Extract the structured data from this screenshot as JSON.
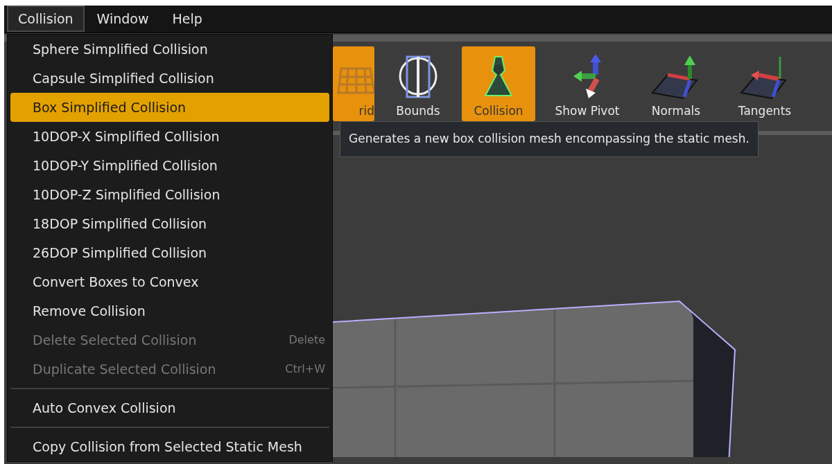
{
  "menubar": [
    {
      "label": "Collision",
      "selected": true
    },
    {
      "label": "Window",
      "selected": false
    },
    {
      "label": "Help",
      "selected": false
    }
  ],
  "menu": [
    {
      "kind": "item",
      "label": "Sphere Simplified Collision",
      "selected": false,
      "disabled": false
    },
    {
      "kind": "item",
      "label": "Capsule Simplified Collision",
      "selected": false,
      "disabled": false
    },
    {
      "kind": "item",
      "label": "Box Simplified Collision",
      "selected": true,
      "disabled": false
    },
    {
      "kind": "item",
      "label": "10DOP-X Simplified Collision",
      "selected": false,
      "disabled": false
    },
    {
      "kind": "item",
      "label": "10DOP-Y Simplified Collision",
      "selected": false,
      "disabled": false
    },
    {
      "kind": "item",
      "label": "10DOP-Z Simplified Collision",
      "selected": false,
      "disabled": false
    },
    {
      "kind": "item",
      "label": "18DOP Simplified Collision",
      "selected": false,
      "disabled": false
    },
    {
      "kind": "item",
      "label": "26DOP Simplified Collision",
      "selected": false,
      "disabled": false
    },
    {
      "kind": "item",
      "label": "Convert Boxes to Convex",
      "selected": false,
      "disabled": false
    },
    {
      "kind": "item",
      "label": "Remove Collision",
      "selected": false,
      "disabled": false
    },
    {
      "kind": "item",
      "label": "Delete Selected Collision",
      "shortcut": "Delete",
      "selected": false,
      "disabled": true
    },
    {
      "kind": "item",
      "label": "Duplicate Selected Collision",
      "shortcut": "Ctrl+W",
      "selected": false,
      "disabled": true
    },
    {
      "kind": "separator"
    },
    {
      "kind": "item",
      "label": "Auto Convex Collision",
      "selected": false,
      "disabled": false
    },
    {
      "kind": "separator"
    },
    {
      "kind": "item",
      "label": "Copy Collision from Selected Static Mesh",
      "selected": false,
      "disabled": false
    }
  ],
  "toolbar": [
    {
      "kind": "grid",
      "label": "rid",
      "selected": true
    },
    {
      "kind": "bounds",
      "label": "Bounds",
      "selected": false
    },
    {
      "kind": "collision",
      "label": "Collision",
      "selected": true
    },
    {
      "kind": "pivot",
      "label": "Show Pivot",
      "selected": false
    },
    {
      "kind": "normals",
      "label": "Normals",
      "selected": false
    },
    {
      "kind": "tangents",
      "label": "Tangents",
      "selected": false
    }
  ],
  "tooltip": "Generates a new box collision mesh encompassing the static mesh."
}
